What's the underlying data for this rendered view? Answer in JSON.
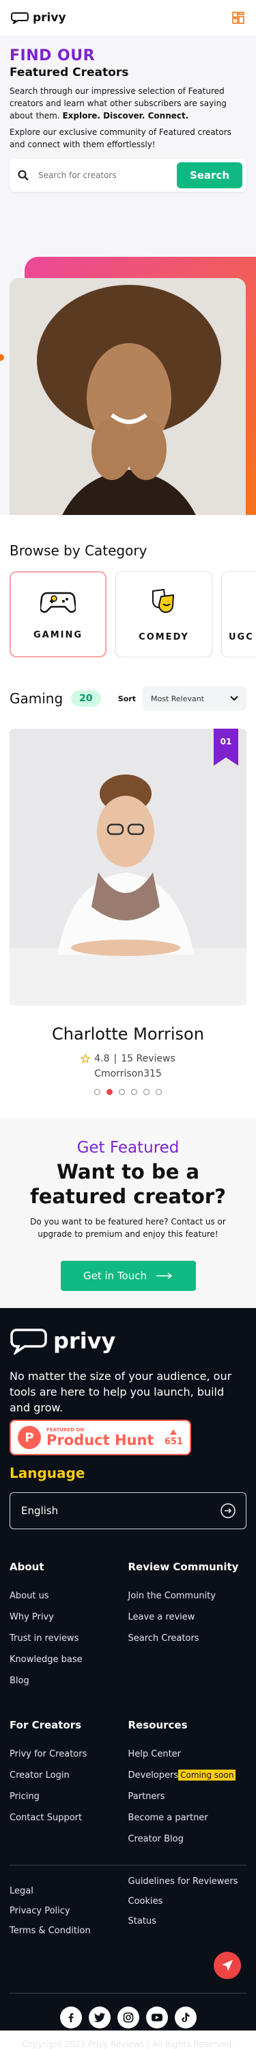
{
  "header": {
    "brand": "privy",
    "menu_icon": "grid-menu-icon"
  },
  "hero": {
    "title_line1": "FIND OUR",
    "title_line2": "Featured Creators",
    "intro": "Search through our impressive selection of Featured creators and learn what other subscribers are saying about them.",
    "intro_bold": "Explore. Discover. Connect.",
    "sub": "Explore our exclusive community of Featured creators and connect with them effortlessly!",
    "search_placeholder": "Search for creators",
    "search_button": "Search",
    "accent": "#7e22ce"
  },
  "categories": {
    "title": "Browse by Category",
    "items": [
      {
        "label": "GAMING",
        "icon": "gamepad-icon",
        "active": true
      },
      {
        "label": "COMEDY",
        "icon": "comedy-masks-icon",
        "active": false
      },
      {
        "label": "UGC",
        "icon": "",
        "active": false
      }
    ]
  },
  "listing": {
    "title": "Gaming",
    "count": "20",
    "sort_label": "Sort",
    "sort_value": "Most Relevant"
  },
  "creator": {
    "rank": "01",
    "name": "Charlotte Morrison",
    "rating": "4.8",
    "reviews": "15 Reviews",
    "handle": "Cmorrison315",
    "slides": 6,
    "active_slide": 2
  },
  "cta": {
    "kicker": "Get Featured",
    "headline": "Want to be a featured creator?",
    "desc": "Do you want to be featured here? Contact us or upgrade to premium and enjoy this feature!",
    "button": "Get in Touch"
  },
  "footer": {
    "brand": "privy",
    "tagline": "No matter the size of your audience, our tools are here to help you launch, build and grow.",
    "ph_small": "FEATURED ON",
    "ph_big": "Product Hunt",
    "ph_count": "651",
    "language_title": "Language",
    "language_value": "English",
    "about": {
      "title": "About",
      "links": [
        "About us",
        "Why Privy",
        "Trust in reviews",
        "Knowledge base",
        "Blog"
      ]
    },
    "review": {
      "title": "Review Community",
      "links": [
        "Join the Community",
        "Leave a review",
        "Search Creators"
      ]
    },
    "creators": {
      "title": "For Creators",
      "links": [
        "Privy for Creators",
        "Creator Login",
        "Pricing",
        "Contact Support"
      ]
    },
    "resources": {
      "title": "Resources",
      "links": [
        "Help Center",
        "Developers",
        "Partners",
        "Become a partner",
        "Creator Blog"
      ],
      "soon": "Coming soon"
    },
    "legal_left": [
      "Legal",
      "Privacy Policy",
      "Terms & Condition"
    ],
    "legal_right": [
      "Guidelines for Reviewers",
      "Cookies",
      "Status"
    ],
    "socials": [
      "facebook-icon",
      "twitter-icon",
      "instagram-icon",
      "youtube-icon",
      "tiktok-icon"
    ],
    "copyright": "Copyright 2023 Privy Reviews | All Rights Reserved."
  }
}
